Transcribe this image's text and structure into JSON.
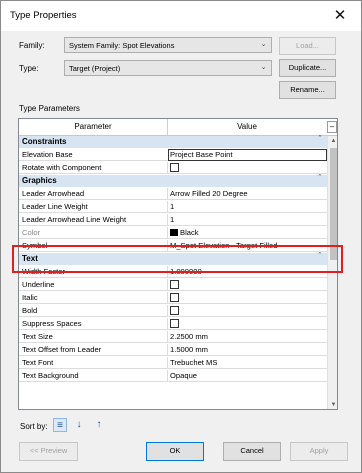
{
  "window": {
    "title": "Type Properties",
    "close_glyph": "✕"
  },
  "family": {
    "label": "Family:",
    "value": "System Family: Spot Elevations",
    "load_label": "Load..."
  },
  "type": {
    "label": "Type:",
    "value": "Target (Project)",
    "duplicate_label": "Duplicate...",
    "rename_label": "Rename..."
  },
  "type_parameters": {
    "heading": "Type Parameters"
  },
  "grid": {
    "col_parameter": "Parameter",
    "col_value": "Value",
    "header_toggle": "–",
    "groups": {
      "constraints": "Constraints",
      "graphics": "Graphics",
      "text": "Text"
    },
    "rows": {
      "elevation_base": {
        "name": "Elevation Base",
        "value": "Project Base Point"
      },
      "rotate_with_component": {
        "name": "Rotate with Component"
      },
      "leader_arrowhead": {
        "name": "Leader Arrowhead",
        "value": "Arrow Filled 20 Degree"
      },
      "leader_line_weight": {
        "name": "Leader Line Weight",
        "value": "1"
      },
      "leader_arrowhead_line_weight": {
        "name": "Leader Arrowhead Line Weight",
        "value": "1"
      },
      "color": {
        "name": "Color",
        "value": "Black"
      },
      "symbol": {
        "name": "Symbol",
        "value": "M_Spot Elevation - Target Filled"
      },
      "width_factor": {
        "name": "Width Factor",
        "value": "1.000000"
      },
      "underline": {
        "name": "Underline"
      },
      "italic": {
        "name": "Italic"
      },
      "bold": {
        "name": "Bold"
      },
      "suppress_spaces": {
        "name": "Suppress Spaces"
      },
      "text_size": {
        "name": "Text Size",
        "value": "2.2500 mm"
      },
      "text_offset_from_leader": {
        "name": "Text Offset from Leader",
        "value": "1.5000 mm"
      },
      "text_font": {
        "name": "Text Font",
        "value": "Trebuchet MS"
      },
      "text_background": {
        "name": "Text Background",
        "value": "Opaque"
      }
    }
  },
  "sort": {
    "label": "Sort by:"
  },
  "footer": {
    "preview_label": "<< Preview",
    "ok_label": "OK",
    "cancel_label": "Cancel",
    "apply_label": "Apply"
  },
  "colors": {
    "highlight": "#e02020",
    "group_bg": "#d7e4f2",
    "color_swatch": "#000000"
  }
}
